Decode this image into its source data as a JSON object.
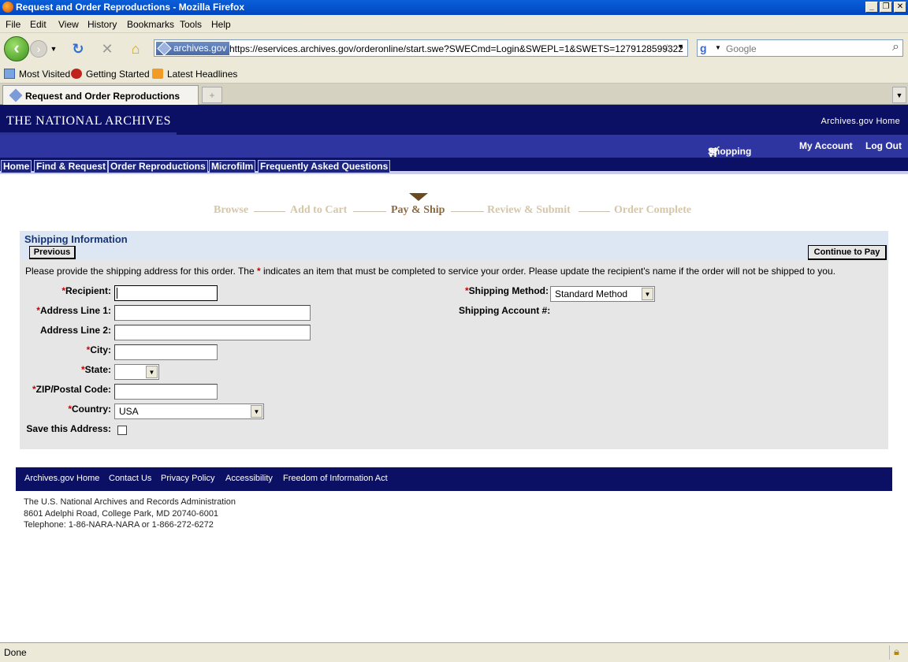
{
  "window": {
    "title": "Request and Order Reproductions - Mozilla Firefox"
  },
  "menu": [
    "File",
    "Edit",
    "View",
    "History",
    "Bookmarks",
    "Tools",
    "Help"
  ],
  "nav": {
    "site_badge": "archives.gov",
    "url": "https://eservices.archives.gov/orderonline/start.swe?SWECmd=Login&SWEPL=1&SWETS=1279128599322",
    "search_placeholder": "Google"
  },
  "bookmarks": [
    "Most Visited",
    "Getting Started",
    "Latest Headlines"
  ],
  "tab": {
    "label": "Request and Order Reproductions"
  },
  "site": {
    "logo": "THE NATIONAL ARCHIVES",
    "home_link": "Archives.gov Home",
    "shopping_cart": "Shopping Cart",
    "my_account": "My Account",
    "log_out": "Log Out",
    "nav_tabs": [
      "Home",
      "Find & Request",
      "Order Reproductions",
      "Microfilm",
      "Frequently Asked Questions"
    ]
  },
  "steps": [
    "Browse",
    "Add to Cart",
    "Pay & Ship",
    "Review & Submit",
    "Order Complete"
  ],
  "active_step": "Pay & Ship",
  "form": {
    "title": "Shipping Information",
    "previous": "Previous",
    "continue": "Continue to Pay",
    "instructions_pre": "Please provide the shipping address for this order. The ",
    "required_marker": "*",
    "instructions_post": " indicates an item that must be completed to service your order. Please update the recipient's name if the order will not be shipped to you.",
    "recipient_label": "Recipient:",
    "address1_label": "Address Line 1:",
    "address2_label": "Address Line 2:",
    "city_label": "City:",
    "state_label": "State:",
    "zip_label": "ZIP/Postal Code:",
    "country_label": "Country:",
    "country_value": "USA",
    "save_label": "Save this Address:",
    "shipping_method_label": "Shipping Method:",
    "shipping_method_value": "Standard Method",
    "shipping_account_label": "Shipping Account #:"
  },
  "footer": {
    "links": [
      "Archives.gov Home",
      "Contact Us",
      "Privacy Policy",
      "Accessibility",
      "Freedom of Information Act"
    ],
    "address": [
      "The U.S. National Archives and Records Administration",
      "8601 Adelphi Road, College Park, MD 20740-6001",
      "Telephone: 1-86-NARA-NARA or 1-866-272-6272"
    ]
  },
  "status": "Done",
  "colors": {
    "site_header": "#0c1064",
    "site_subheader": "#2f35a0",
    "panel_bg": "#e6e6e6",
    "panel_header": "#dde6f3",
    "required": "#cc0000",
    "active_step": "#8c6a42"
  }
}
